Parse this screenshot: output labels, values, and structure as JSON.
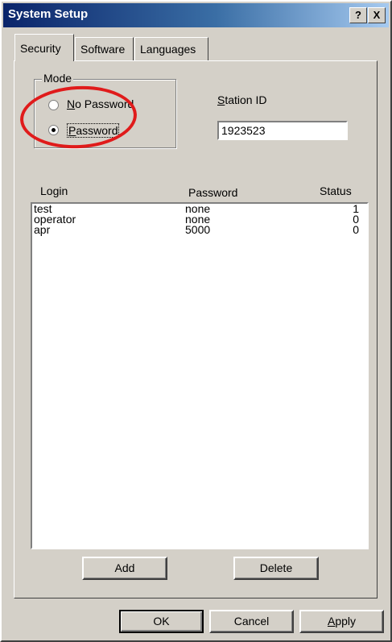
{
  "window": {
    "title": "System Setup",
    "help_label": "?",
    "close_label": "X"
  },
  "tabs": [
    {
      "label": "Security",
      "active": true
    },
    {
      "label": "Software",
      "active": false
    },
    {
      "label": "Languages",
      "active": false
    }
  ],
  "mode": {
    "group_label": "Mode",
    "options": [
      {
        "label": "No Password",
        "selected": false
      },
      {
        "label": "Password",
        "selected": true
      }
    ]
  },
  "station": {
    "label": "Station ID",
    "value": "1923523"
  },
  "list": {
    "headers": {
      "login": "Login",
      "password": "Password",
      "status": "Status"
    },
    "rows": [
      {
        "login": "test",
        "password": "none",
        "status": "1"
      },
      {
        "login": "operator",
        "password": "none",
        "status": "0"
      },
      {
        "login": "apr",
        "password": "5000",
        "status": "0"
      }
    ]
  },
  "buttons": {
    "add": "Add",
    "delete": "Delete",
    "ok": "OK",
    "cancel": "Cancel",
    "apply": "Apply"
  },
  "colors": {
    "dialog_face": "#d4d0c8",
    "title_gradient_start": "#0a246a",
    "annotation_circle": "#e01b1b"
  }
}
